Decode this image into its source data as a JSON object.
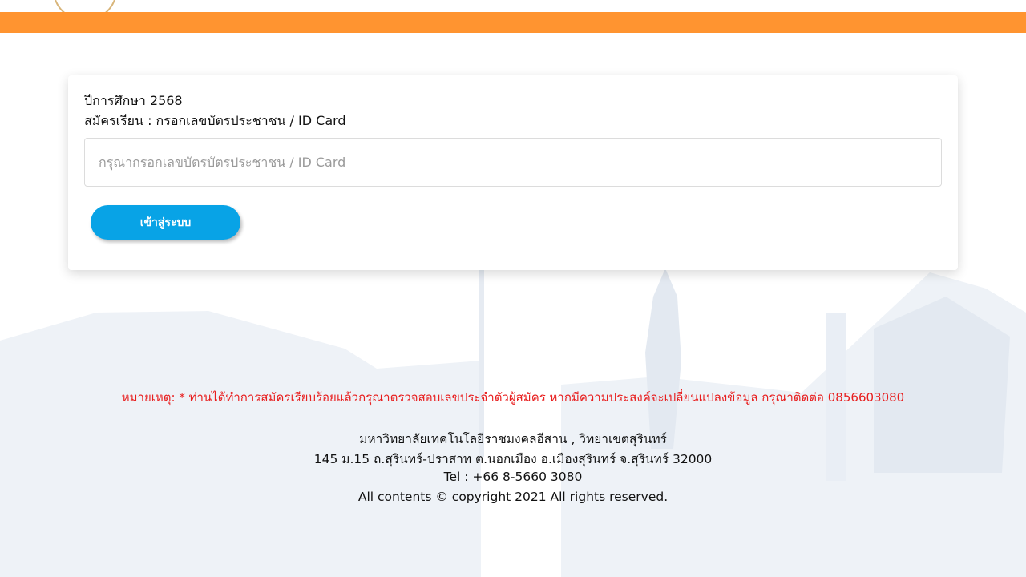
{
  "header": {
    "logo_icon": "university-seal-icon",
    "bar_color": "#ff9430"
  },
  "form": {
    "academic_year_label": "ปีการศึกษา 2568",
    "apply_label": "สมัครเรียน : กรอกเลขบัตรประชาชน / ID Card",
    "id_card_input": {
      "value": "",
      "placeholder": "กรุณากรอกเลขบัตรบัตรประชาชน / ID Card"
    },
    "login_button_label": "เข้าสู่ระบบ",
    "button_color": "#08a3e6"
  },
  "footer": {
    "notice": "หมายเหตุ: * ท่านได้ทำการสมัครเรียบร้อยแล้วกรุณาตรวจสอบเลขประจำตัวผู้สมัคร หากมีความประสงค์จะเปลี่ยนแปลงข้อมูล กรุณาติดต่อ 0856603080",
    "notice_color": "#e81e1e",
    "institution": "มหาวิทยาลัยเทคโนโลยีราชมงคลอีสาน , วิทยาเขตสุรินทร์",
    "address": "145 ม.15 ถ.สุรินทร์-ปราสาท ต.นอกเมือง อ.เมืองสุรินทร์ จ.สุรินทร์ 32000",
    "tel": "Tel : +66 8-5660 3080",
    "copyright": "All contents © copyright 2021 All rights reserved."
  }
}
